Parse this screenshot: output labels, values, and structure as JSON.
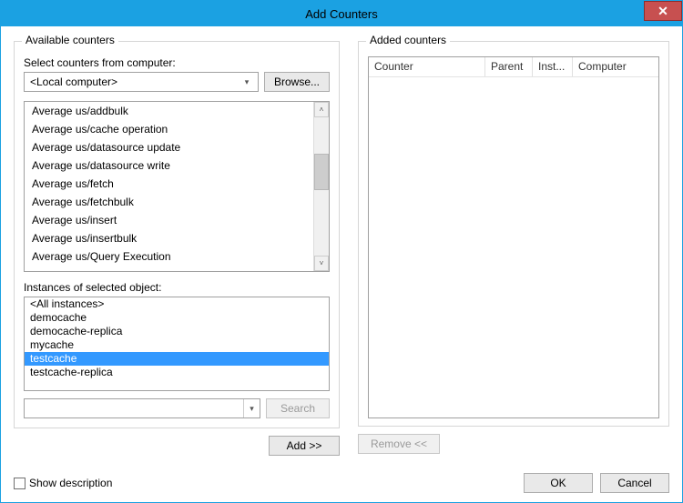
{
  "window": {
    "title": "Add Counters"
  },
  "left": {
    "group_label": "Available counters",
    "select_label": "Select counters from computer:",
    "computer_value": "<Local computer>",
    "browse_label": "Browse...",
    "counters": [
      "Average us/addbulk",
      "Average us/cache operation",
      "Average us/datasource update",
      "Average us/datasource write",
      "Average us/fetch",
      "Average us/fetchbulk",
      "Average us/insert",
      "Average us/insertbulk",
      "Average us/Query Execution"
    ],
    "instances_label": "Instances of selected object:",
    "instances": [
      {
        "label": "<All instances>",
        "selected": false
      },
      {
        "label": "democache",
        "selected": false
      },
      {
        "label": "democache-replica",
        "selected": false
      },
      {
        "label": "mycache",
        "selected": false
      },
      {
        "label": "testcache",
        "selected": true
      },
      {
        "label": "testcache-replica",
        "selected": false
      }
    ],
    "search_label": "Search",
    "add_label": "Add >>"
  },
  "right": {
    "group_label": "Added counters",
    "columns": {
      "counter": "Counter",
      "parent": "Parent",
      "inst": "Inst...",
      "computer": "Computer"
    },
    "remove_label": "Remove <<"
  },
  "footer": {
    "show_description": "Show description",
    "ok": "OK",
    "cancel": "Cancel"
  }
}
